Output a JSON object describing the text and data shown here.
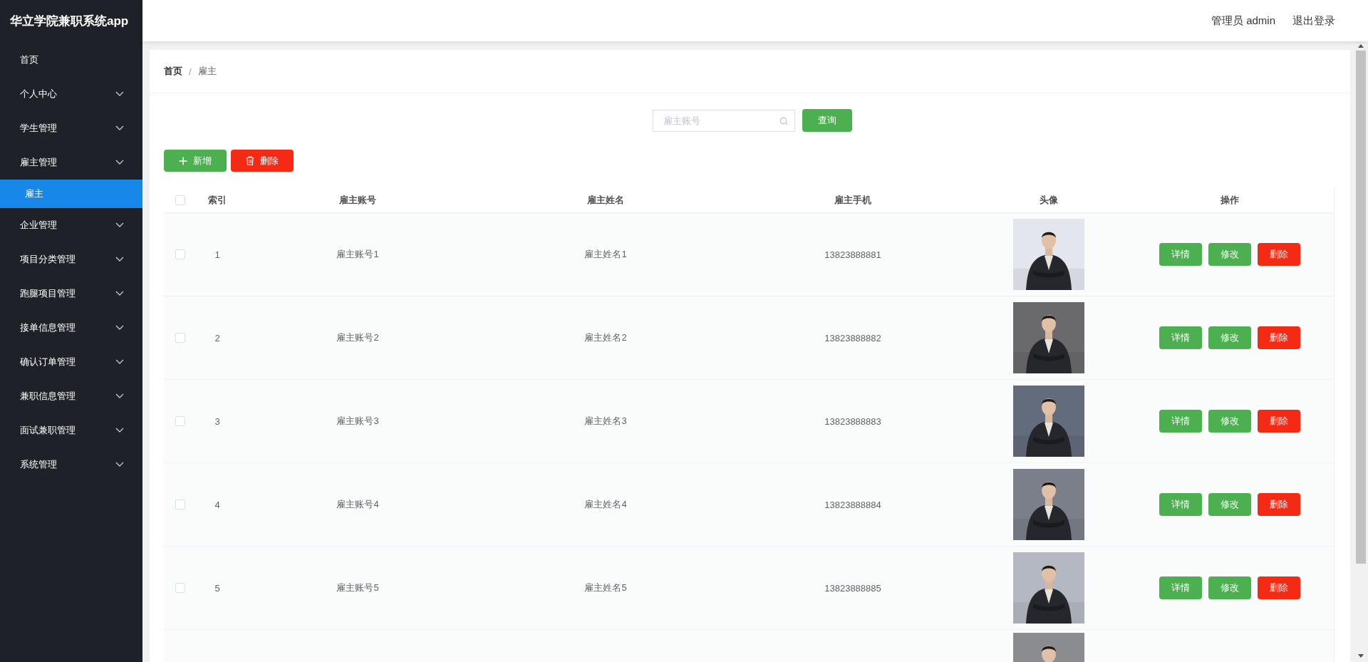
{
  "app_title": "华立学院兼职系统app",
  "sidebar": {
    "items": [
      {
        "label": "首页",
        "expandable": false,
        "selected": false
      },
      {
        "label": "个人中心",
        "expandable": true,
        "selected": false
      },
      {
        "label": "学生管理",
        "expandable": true,
        "selected": false
      },
      {
        "label": "雇主管理",
        "expandable": true,
        "selected": false,
        "children": [
          {
            "label": "雇主",
            "selected": true
          }
        ]
      },
      {
        "label": "企业管理",
        "expandable": true,
        "selected": false
      },
      {
        "label": "项目分类管理",
        "expandable": true,
        "selected": false
      },
      {
        "label": "跑腿项目管理",
        "expandable": true,
        "selected": false
      },
      {
        "label": "接单信息管理",
        "expandable": true,
        "selected": false
      },
      {
        "label": "确认订单管理",
        "expandable": true,
        "selected": false
      },
      {
        "label": "兼职信息管理",
        "expandable": true,
        "selected": false
      },
      {
        "label": "面试兼职管理",
        "expandable": true,
        "selected": false
      },
      {
        "label": "系统管理",
        "expandable": true,
        "selected": false
      }
    ]
  },
  "header": {
    "user": "管理员 admin",
    "logout": "退出登录"
  },
  "breadcrumb": [
    "首页",
    "雇主"
  ],
  "breadcrumb_separator": "/",
  "search": {
    "placeholder": "雇主账号",
    "button": "查询"
  },
  "toolbar": [
    {
      "label": "新增",
      "kind": "add"
    },
    {
      "label": "删除",
      "kind": "delete"
    }
  ],
  "table": {
    "select_all_checked": false,
    "columns": [
      "索引",
      "雇主账号",
      "雇主姓名",
      "雇主手机",
      "头像",
      "操作"
    ],
    "rows": [
      {
        "checked": false,
        "index": "1",
        "account": "雇主账号1",
        "name": "雇主姓名1",
        "phone": "13823888881",
        "photo": {
          "kind": "picture"
        },
        "actions": [
          {
            "label": "详情",
            "kind": "primary"
          },
          {
            "label": "修改",
            "kind": "primary"
          },
          {
            "label": "删除",
            "kind": "danger"
          }
        ]
      },
      {
        "checked": false,
        "index": "2",
        "account": "雇主账号2",
        "name": "雇主姓名2",
        "phone": "13823888882",
        "photo": {
          "kind": "picture"
        },
        "actions": [
          {
            "label": "详情",
            "kind": "primary"
          },
          {
            "label": "修改",
            "kind": "primary"
          },
          {
            "label": "删除",
            "kind": "danger"
          }
        ]
      },
      {
        "checked": false,
        "index": "3",
        "account": "雇主账号3",
        "name": "雇主姓名3",
        "phone": "13823888883",
        "photo": {
          "kind": "picture"
        },
        "actions": [
          {
            "label": "详情",
            "kind": "primary"
          },
          {
            "label": "修改",
            "kind": "primary"
          },
          {
            "label": "删除",
            "kind": "danger"
          }
        ]
      },
      {
        "checked": false,
        "index": "4",
        "account": "雇主账号4",
        "name": "雇主姓名4",
        "phone": "13823888884",
        "photo": {
          "kind": "picture"
        },
        "actions": [
          {
            "label": "详情",
            "kind": "primary"
          },
          {
            "label": "修改",
            "kind": "primary"
          },
          {
            "label": "删除",
            "kind": "danger"
          }
        ]
      },
      {
        "checked": false,
        "index": "5",
        "account": "雇主账号5",
        "name": "雇主姓名5",
        "phone": "13823888885",
        "photo": {
          "kind": "picture"
        },
        "actions": [
          {
            "label": "详情",
            "kind": "primary"
          },
          {
            "label": "修改",
            "kind": "primary"
          },
          {
            "label": "删除",
            "kind": "danger"
          }
        ]
      },
      {
        "photo": {
          "kind": "picture"
        }
      }
    ]
  }
}
